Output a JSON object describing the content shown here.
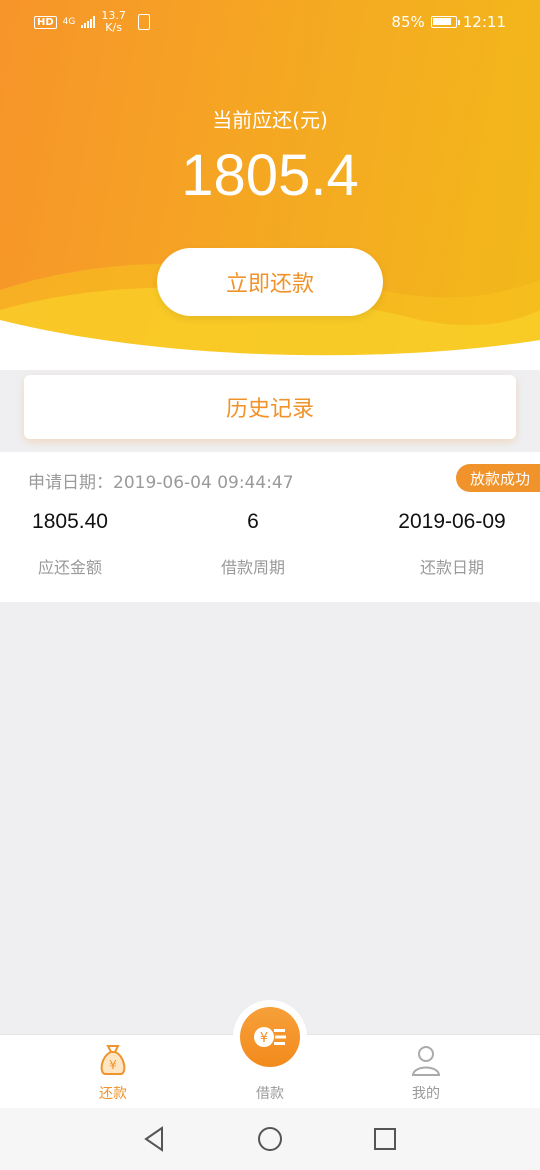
{
  "status_bar": {
    "hd": "HD",
    "network": "4G",
    "speed_value": "13.7",
    "speed_unit": "K/s",
    "battery": "85%",
    "battery_level": 0.85,
    "time": "12:11"
  },
  "header": {
    "due_label": "当前应还(元)",
    "due_amount": "1805.4",
    "repay_button": "立即还款"
  },
  "history": {
    "title": "历史记录",
    "record": {
      "apply_label": "申请日期：",
      "apply_datetime": "2019-06-04 09:44:47",
      "status": "放款成功",
      "amount_value": "1805.40",
      "amount_label": "应还金额",
      "period_value": "6",
      "period_label": "借款周期",
      "due_date_value": "2019-06-09",
      "due_date_label": "还款日期"
    }
  },
  "tabs": [
    {
      "label": "还款",
      "icon": "money-bag-icon",
      "active": true
    },
    {
      "label": "借款",
      "icon": "coin-stack-icon",
      "active": false
    },
    {
      "label": "我的",
      "icon": "user-icon",
      "active": false
    }
  ],
  "colors": {
    "accent": "#f0932b",
    "header_start": "#f7942a",
    "header_end": "#f2b91a"
  },
  "nav": {
    "back_icon": "back-triangle-icon",
    "home_icon": "home-circle-icon",
    "recents_icon": "recents-square-icon"
  }
}
